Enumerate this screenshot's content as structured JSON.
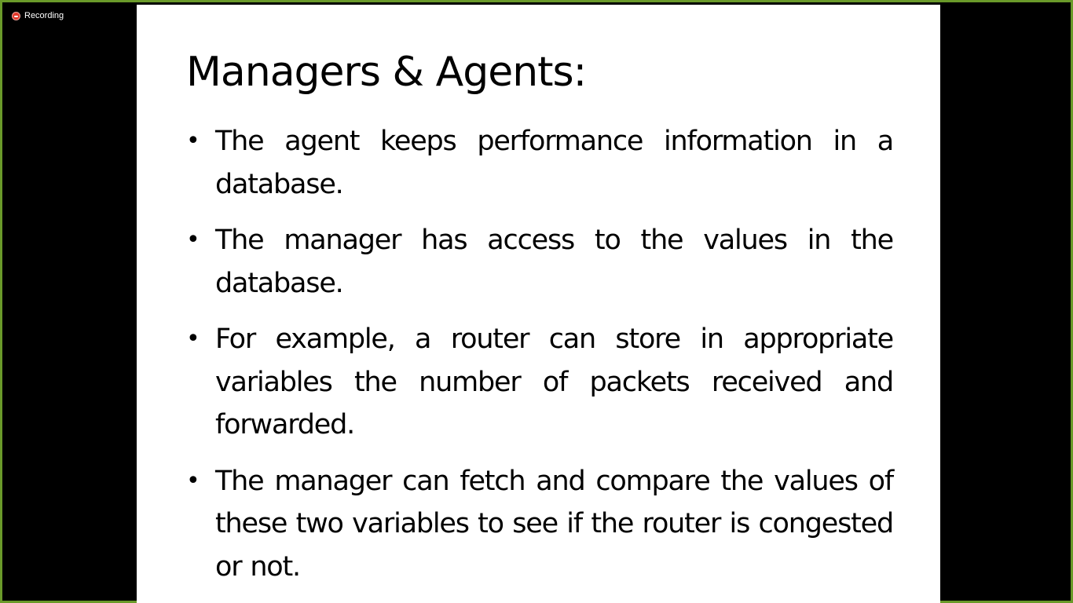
{
  "recording": {
    "label": "Recording",
    "color": "#e0382b"
  },
  "slide": {
    "title": "Managers & Agents:",
    "bullet_glyph": "•",
    "bullets": [
      "The agent keeps performance information in a database.",
      "The manager has access to the values in the database.",
      "For example, a router can store in appropriate variables the number of packets received and forwarded.",
      "The manager can fetch and compare the values of these two variables to see if the router is congested or not."
    ]
  },
  "colors": {
    "window_border": "#6a9a2a",
    "background": "#000000",
    "slide_background": "#ffffff"
  }
}
